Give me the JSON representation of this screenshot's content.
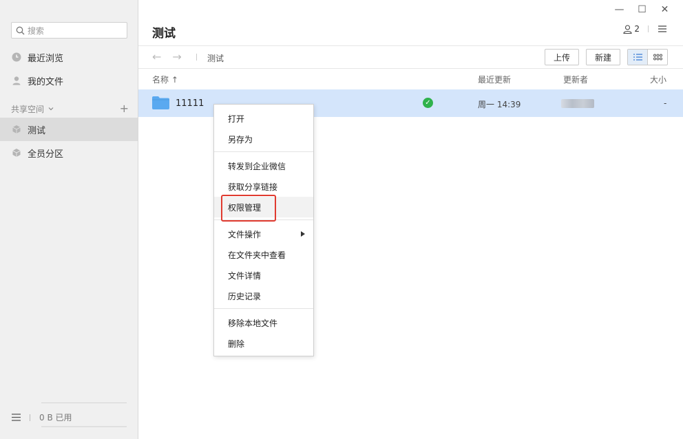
{
  "sidebar": {
    "search_placeholder": "搜索",
    "recent": "最近浏览",
    "my_files": "我的文件",
    "shared_space": "共享空间",
    "spaces": [
      "测试",
      "全员分区"
    ],
    "usage": "0 B 已用"
  },
  "header": {
    "title": "测试",
    "members": "2"
  },
  "toolbar": {
    "breadcrumb": "测试",
    "upload": "上传",
    "new": "新建"
  },
  "columns": {
    "name": "名称 ↑",
    "updated": "最近更新",
    "updater": "更新者",
    "size": "大小"
  },
  "files": [
    {
      "name": "11111",
      "updated": "周一 14:39",
      "size": "-"
    }
  ],
  "context_menu": {
    "items": [
      "打开",
      "另存为",
      "转发到企业微信",
      "获取分享链接",
      "权限管理",
      "文件操作",
      "在文件夹中查看",
      "文件详情",
      "历史记录",
      "移除本地文件",
      "删除"
    ]
  },
  "colors": {
    "selected_row": "#d4e5fb",
    "highlight_box": "#e03a2f",
    "sync_ok": "#2fb24c",
    "folder": "#5aa9f0"
  }
}
